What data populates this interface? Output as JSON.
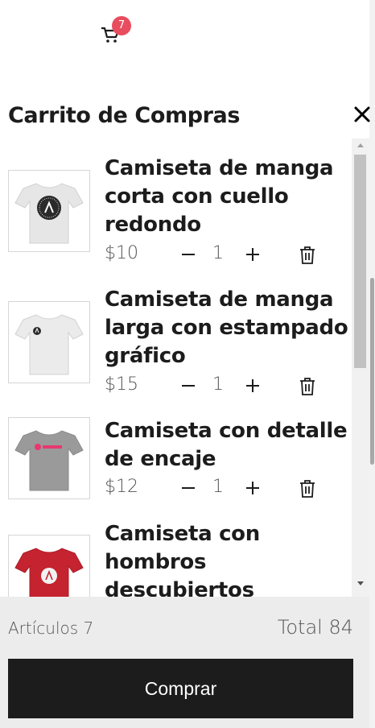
{
  "header": {
    "cart_icon": "cart-icon",
    "cart_count": "7"
  },
  "drawer": {
    "title": "Carrito de Compras",
    "close_icon": "close-icon",
    "items": [
      {
        "title": "Camiseta de manga corta con cuello redondo",
        "price": "$10",
        "qty": "1",
        "shirt_color": "#e6e6e6",
        "image": "white-tshirt-round-logo"
      },
      {
        "title": "Camiseta de manga larga con estampado gráfico",
        "price": "$15",
        "qty": "1",
        "shirt_color": "#ebebeb",
        "image": "white-tshirt-small-logo"
      },
      {
        "title": "Camiseta con detalle de encaje",
        "price": "$12",
        "qty": "1",
        "shirt_color": "#9a9a9a",
        "image": "grey-tshirt-pink-logo"
      },
      {
        "title": "Camiseta con hombros descubiertos",
        "price": "",
        "qty": "",
        "shirt_color": "#c4232f",
        "image": "red-tshirt-academy"
      }
    ],
    "icons": {
      "minus": "minus-icon",
      "plus": "plus-icon",
      "trash": "trash-icon"
    }
  },
  "footer": {
    "items_label": "Artículos 7",
    "total_label": "Total 84",
    "buy_label": "Comprar"
  },
  "colors": {
    "accent_badge": "#e84d5f",
    "button_bg": "#1c1c1c",
    "footer_bg": "#ececec"
  }
}
